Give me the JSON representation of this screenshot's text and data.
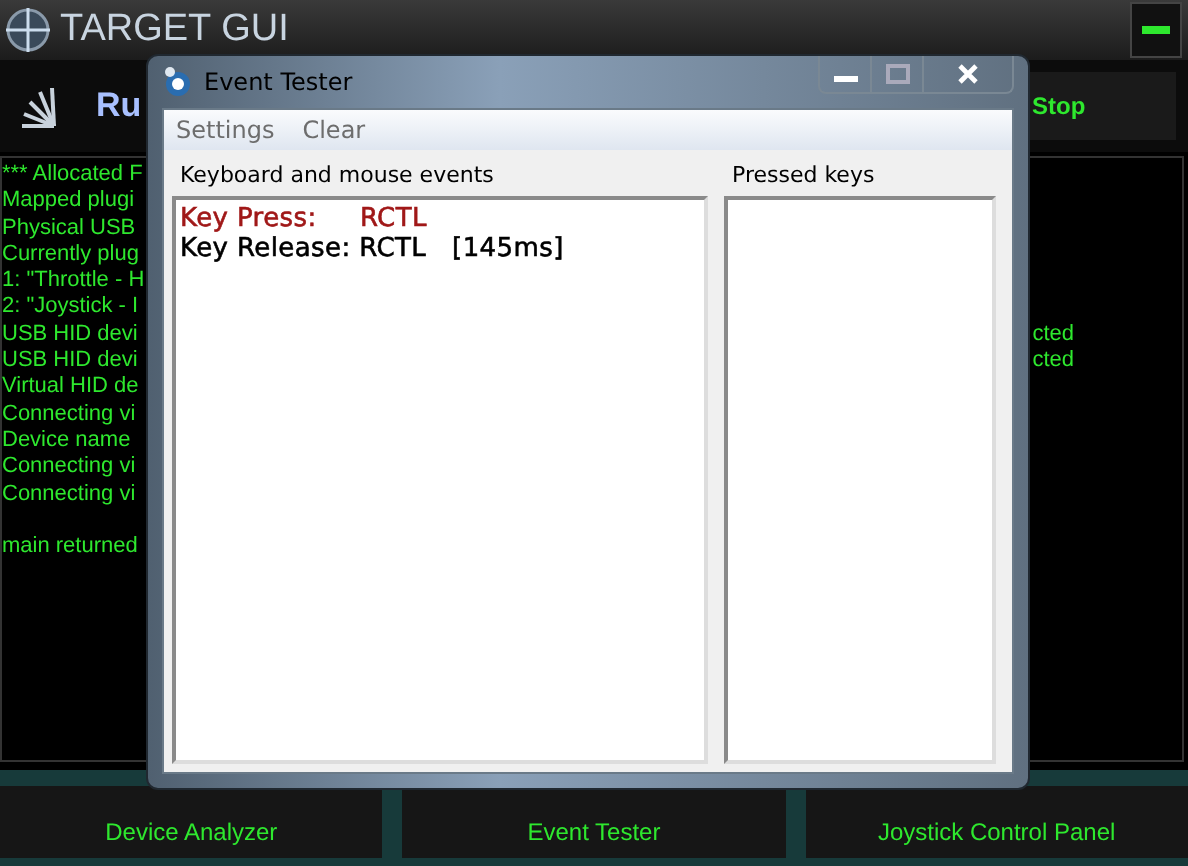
{
  "app": {
    "title": "TARGET GUI",
    "run_label": "Ru",
    "stop_button": "Stop",
    "log_lines": [
      {
        "text": "*** Allocated F"
      },
      {
        "text": "Mapped plugi"
      },
      {
        "text": "Physical USB"
      },
      {
        "text": "Currently plug"
      },
      {
        "text": "1: \"Throttle - H"
      },
      {
        "text": "2: \"Joystick - I"
      },
      {
        "text": "USB HID devi",
        "tail": "cted"
      },
      {
        "text": "USB HID devi",
        "tail": "cted"
      },
      {
        "text": "Virtual HID de"
      },
      {
        "text": "Connecting vi"
      },
      {
        "text": "Device name"
      },
      {
        "text": "Connecting vi"
      },
      {
        "text": "Connecting vi"
      },
      {
        "text": "main returned",
        "spaced": true
      }
    ],
    "bottom_buttons": [
      "Device Analyzer",
      "Event Tester",
      "Joystick Control Panel"
    ]
  },
  "dialog": {
    "title": "Event Tester",
    "menu": [
      "Settings",
      "Clear"
    ],
    "events_label": "Keyboard and mouse events",
    "pressed_label": "Pressed keys",
    "events": [
      {
        "kind": "press",
        "text": "Key Press:     RCTL"
      },
      {
        "kind": "release",
        "text": "Key Release: RCTL   [145ms]"
      }
    ]
  }
}
